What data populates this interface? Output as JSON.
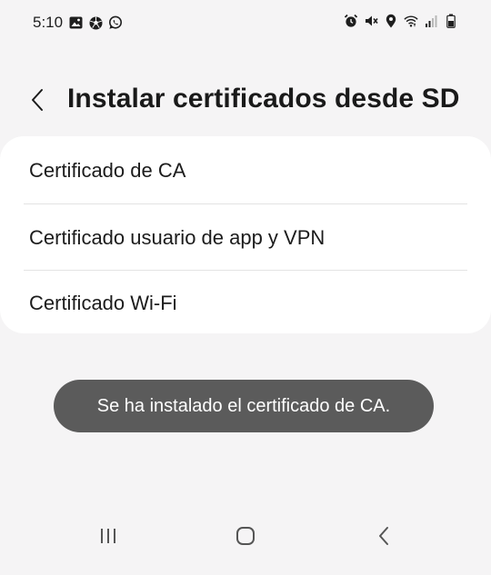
{
  "status_bar": {
    "time": "5:10",
    "left_icons": [
      "gallery-icon",
      "soccer-ball-icon",
      "whatsapp-icon"
    ],
    "right_icons": [
      "alarm-icon",
      "mute-icon",
      "location-icon",
      "wifi-icon",
      "signal-icon",
      "battery-icon"
    ]
  },
  "header": {
    "title": "Instalar certificados desde SD",
    "back_icon": "chevron-left-icon"
  },
  "certificates": {
    "items": [
      {
        "label": "Certificado de CA"
      },
      {
        "label": "Certificado usuario de app y VPN"
      },
      {
        "label": "Certificado Wi-Fi"
      }
    ]
  },
  "toast": {
    "message": "Se ha instalado el certificado de CA."
  },
  "nav_bar": {
    "icons": [
      "recent-apps-icon",
      "home-icon",
      "back-icon"
    ]
  },
  "colors": {
    "background": "#f5f4f5",
    "card": "#ffffff",
    "toast": "#5b5b5b",
    "text": "#1c1c1c"
  }
}
